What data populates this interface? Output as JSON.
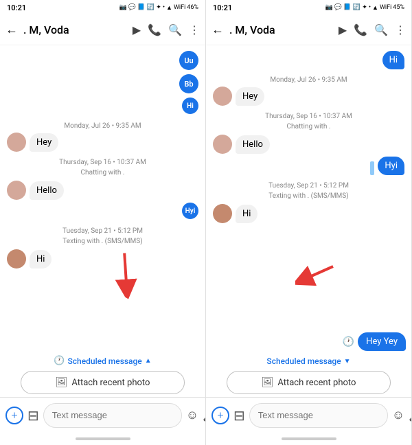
{
  "screen1": {
    "status": {
      "time": "10:21",
      "battery": "46%"
    },
    "header": {
      "contact": ". M, Voda",
      "back": "←"
    },
    "messages": [
      {
        "type": "blue-avatar",
        "text": "Uu"
      },
      {
        "type": "blue-avatar",
        "text": "Bb"
      },
      {
        "type": "blue-avatar-small",
        "text": "Hi"
      },
      {
        "type": "date",
        "text": "Monday, Jul 26 • 9:35 AM"
      },
      {
        "type": "received",
        "text": "Hey"
      },
      {
        "type": "date",
        "text": "Thursday, Sep 16 • 10:37 AM"
      },
      {
        "type": "sub",
        "text": "Chatting with ."
      },
      {
        "type": "received",
        "text": "Hello"
      },
      {
        "type": "blue-avatar",
        "text": "Hyi"
      },
      {
        "type": "date",
        "text": "Tuesday, Sep 21 • 5:12 PM"
      },
      {
        "type": "sub",
        "text": "Texting with . (SMS/MMS)"
      },
      {
        "type": "received",
        "text": "Hi"
      }
    ],
    "scheduled": {
      "label": "Scheduled message",
      "chevron": "▲"
    },
    "attach_button": "Attach recent photo",
    "input_placeholder": "Text message",
    "bottom_icons": {
      "add": "+",
      "gallery": "⊞",
      "emoji": "☺",
      "mic": "🎤"
    }
  },
  "screen2": {
    "status": {
      "time": "10:21",
      "battery": "45%"
    },
    "header": {
      "contact": ". M, Voda",
      "back": "←"
    },
    "messages": [
      {
        "type": "sent",
        "text": "Hi"
      },
      {
        "type": "date",
        "text": "Monday, Jul 26 • 9:35 AM"
      },
      {
        "type": "received",
        "text": "Hey"
      },
      {
        "type": "date",
        "text": "Thursday, Sep 16 • 10:37 AM"
      },
      {
        "type": "sub",
        "text": "Chatting with ."
      },
      {
        "type": "received",
        "text": "Hello"
      },
      {
        "type": "sent-hyi",
        "text": "Hyi"
      },
      {
        "type": "date",
        "text": "Tuesday, Sep 21 • 5:12 PM"
      },
      {
        "type": "sub",
        "text": "Texting with . (SMS/MMS)"
      },
      {
        "type": "received",
        "text": "Hi"
      }
    ],
    "scheduled_preview": {
      "hey_yey": "Hey Yey"
    },
    "scheduled": {
      "label": "Scheduled message",
      "chevron": "▼"
    },
    "attach_button": "Attach recent photo",
    "input_placeholder": "Text message",
    "bottom_icons": {
      "add": "+",
      "gallery": "⊞",
      "emoji": "☺",
      "mic": "🎤"
    }
  },
  "icons": {
    "search": "🔍",
    "phone": "📞",
    "more_vert": "⋮",
    "clock": "🕐",
    "photo": "🖼",
    "back": "←"
  }
}
